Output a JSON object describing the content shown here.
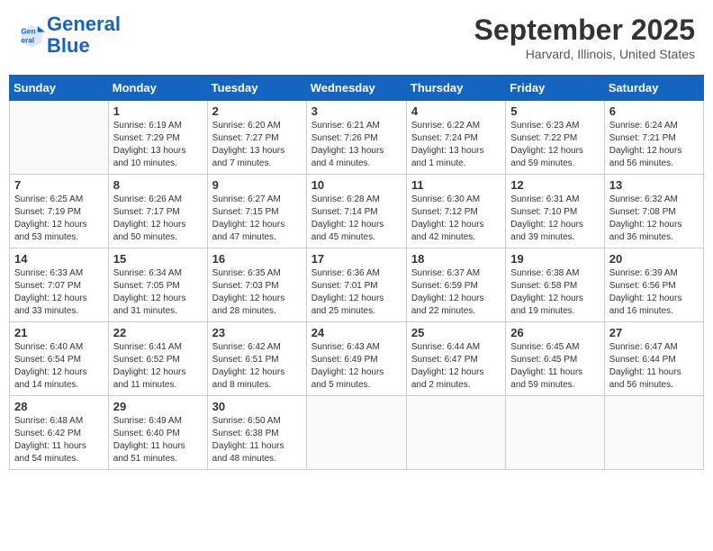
{
  "header": {
    "logo_line1": "General",
    "logo_line2": "Blue",
    "month": "September 2025",
    "location": "Harvard, Illinois, United States"
  },
  "weekdays": [
    "Sunday",
    "Monday",
    "Tuesday",
    "Wednesday",
    "Thursday",
    "Friday",
    "Saturday"
  ],
  "weeks": [
    [
      {
        "day": "",
        "info": ""
      },
      {
        "day": "1",
        "info": "Sunrise: 6:19 AM\nSunset: 7:29 PM\nDaylight: 13 hours\nand 10 minutes."
      },
      {
        "day": "2",
        "info": "Sunrise: 6:20 AM\nSunset: 7:27 PM\nDaylight: 13 hours\nand 7 minutes."
      },
      {
        "day": "3",
        "info": "Sunrise: 6:21 AM\nSunset: 7:26 PM\nDaylight: 13 hours\nand 4 minutes."
      },
      {
        "day": "4",
        "info": "Sunrise: 6:22 AM\nSunset: 7:24 PM\nDaylight: 13 hours\nand 1 minute."
      },
      {
        "day": "5",
        "info": "Sunrise: 6:23 AM\nSunset: 7:22 PM\nDaylight: 12 hours\nand 59 minutes."
      },
      {
        "day": "6",
        "info": "Sunrise: 6:24 AM\nSunset: 7:21 PM\nDaylight: 12 hours\nand 56 minutes."
      }
    ],
    [
      {
        "day": "7",
        "info": "Sunrise: 6:25 AM\nSunset: 7:19 PM\nDaylight: 12 hours\nand 53 minutes."
      },
      {
        "day": "8",
        "info": "Sunrise: 6:26 AM\nSunset: 7:17 PM\nDaylight: 12 hours\nand 50 minutes."
      },
      {
        "day": "9",
        "info": "Sunrise: 6:27 AM\nSunset: 7:15 PM\nDaylight: 12 hours\nand 47 minutes."
      },
      {
        "day": "10",
        "info": "Sunrise: 6:28 AM\nSunset: 7:14 PM\nDaylight: 12 hours\nand 45 minutes."
      },
      {
        "day": "11",
        "info": "Sunrise: 6:30 AM\nSunset: 7:12 PM\nDaylight: 12 hours\nand 42 minutes."
      },
      {
        "day": "12",
        "info": "Sunrise: 6:31 AM\nSunset: 7:10 PM\nDaylight: 12 hours\nand 39 minutes."
      },
      {
        "day": "13",
        "info": "Sunrise: 6:32 AM\nSunset: 7:08 PM\nDaylight: 12 hours\nand 36 minutes."
      }
    ],
    [
      {
        "day": "14",
        "info": "Sunrise: 6:33 AM\nSunset: 7:07 PM\nDaylight: 12 hours\nand 33 minutes."
      },
      {
        "day": "15",
        "info": "Sunrise: 6:34 AM\nSunset: 7:05 PM\nDaylight: 12 hours\nand 31 minutes."
      },
      {
        "day": "16",
        "info": "Sunrise: 6:35 AM\nSunset: 7:03 PM\nDaylight: 12 hours\nand 28 minutes."
      },
      {
        "day": "17",
        "info": "Sunrise: 6:36 AM\nSunset: 7:01 PM\nDaylight: 12 hours\nand 25 minutes."
      },
      {
        "day": "18",
        "info": "Sunrise: 6:37 AM\nSunset: 6:59 PM\nDaylight: 12 hours\nand 22 minutes."
      },
      {
        "day": "19",
        "info": "Sunrise: 6:38 AM\nSunset: 6:58 PM\nDaylight: 12 hours\nand 19 minutes."
      },
      {
        "day": "20",
        "info": "Sunrise: 6:39 AM\nSunset: 6:56 PM\nDaylight: 12 hours\nand 16 minutes."
      }
    ],
    [
      {
        "day": "21",
        "info": "Sunrise: 6:40 AM\nSunset: 6:54 PM\nDaylight: 12 hours\nand 14 minutes."
      },
      {
        "day": "22",
        "info": "Sunrise: 6:41 AM\nSunset: 6:52 PM\nDaylight: 12 hours\nand 11 minutes."
      },
      {
        "day": "23",
        "info": "Sunrise: 6:42 AM\nSunset: 6:51 PM\nDaylight: 12 hours\nand 8 minutes."
      },
      {
        "day": "24",
        "info": "Sunrise: 6:43 AM\nSunset: 6:49 PM\nDaylight: 12 hours\nand 5 minutes."
      },
      {
        "day": "25",
        "info": "Sunrise: 6:44 AM\nSunset: 6:47 PM\nDaylight: 12 hours\nand 2 minutes."
      },
      {
        "day": "26",
        "info": "Sunrise: 6:45 AM\nSunset: 6:45 PM\nDaylight: 11 hours\nand 59 minutes."
      },
      {
        "day": "27",
        "info": "Sunrise: 6:47 AM\nSunset: 6:44 PM\nDaylight: 11 hours\nand 56 minutes."
      }
    ],
    [
      {
        "day": "28",
        "info": "Sunrise: 6:48 AM\nSunset: 6:42 PM\nDaylight: 11 hours\nand 54 minutes."
      },
      {
        "day": "29",
        "info": "Sunrise: 6:49 AM\nSunset: 6:40 PM\nDaylight: 11 hours\nand 51 minutes."
      },
      {
        "day": "30",
        "info": "Sunrise: 6:50 AM\nSunset: 6:38 PM\nDaylight: 11 hours\nand 48 minutes."
      },
      {
        "day": "",
        "info": ""
      },
      {
        "day": "",
        "info": ""
      },
      {
        "day": "",
        "info": ""
      },
      {
        "day": "",
        "info": ""
      }
    ]
  ]
}
